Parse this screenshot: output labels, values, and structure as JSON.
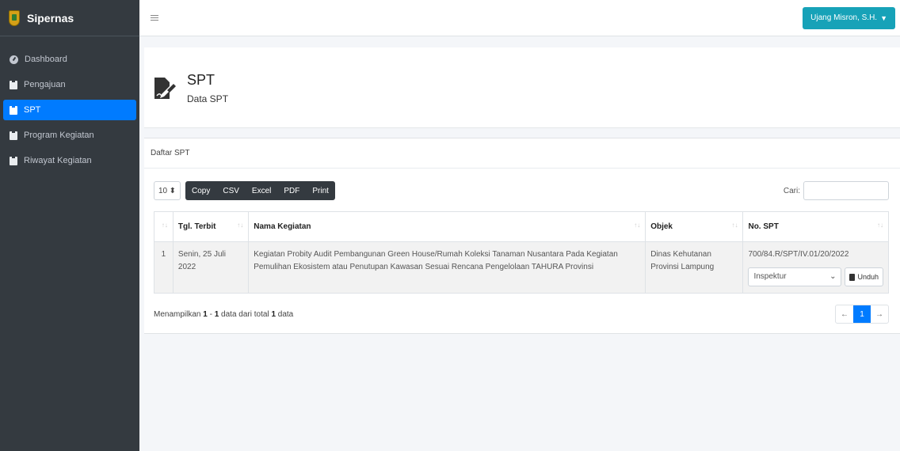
{
  "brand": {
    "name": "Sipernas"
  },
  "sidebar": {
    "items": [
      {
        "label": "Dashboard",
        "icon": "dashboard-icon"
      },
      {
        "label": "Pengajuan",
        "icon": "clipboard-icon"
      },
      {
        "label": "SPT",
        "icon": "clipboard-icon",
        "active": true
      },
      {
        "label": "Program Kegiatan",
        "icon": "clipboard-icon"
      },
      {
        "label": "Riwayat Kegiatan",
        "icon": "clipboard-icon"
      }
    ]
  },
  "topbar": {
    "user": "Ujang Misron, S.H."
  },
  "page": {
    "title": "SPT",
    "subtitle": "Data SPT"
  },
  "card": {
    "title": "Daftar SPT"
  },
  "toolbar": {
    "length": "10",
    "buttons": {
      "copy": "Copy",
      "csv": "CSV",
      "excel": "Excel",
      "pdf": "PDF",
      "print": "Print"
    },
    "search_label": "Cari:",
    "search_value": ""
  },
  "table": {
    "headers": {
      "num": "",
      "date": "Tgl. Terbit",
      "name": "Nama Kegiatan",
      "object": "Objek",
      "spt": "No. SPT"
    },
    "rows": [
      {
        "num": "1",
        "date": "Senin, 25 Juli 2022",
        "name": "Kegiatan Probity Audit Pembangunan Green House/Rumah Koleksi Tanaman Nusantara Pada Kegiatan Pemulihan Ekosistem atau Penutupan Kawasan Sesuai Rencana Pengelolaan TAHURA Provinsi",
        "object": "Dinas Kehutanan Provinsi Lampung",
        "spt": "700/84.R/SPT/IV.01/20/2022",
        "role": "Inspektur",
        "download": "Unduh"
      }
    ]
  },
  "footer": {
    "prefix": "Menampilkan ",
    "from": "1",
    "sep": " - ",
    "to": "1",
    "mid": " data dari total ",
    "total": "1",
    "suffix": " data"
  },
  "pagination": {
    "prev": "←",
    "current": "1",
    "next": "→"
  },
  "colors": {
    "sidebar": "#343a40",
    "active": "#007bff",
    "user_button": "#17a2b8",
    "toolbar_buttons": "#343a40"
  }
}
